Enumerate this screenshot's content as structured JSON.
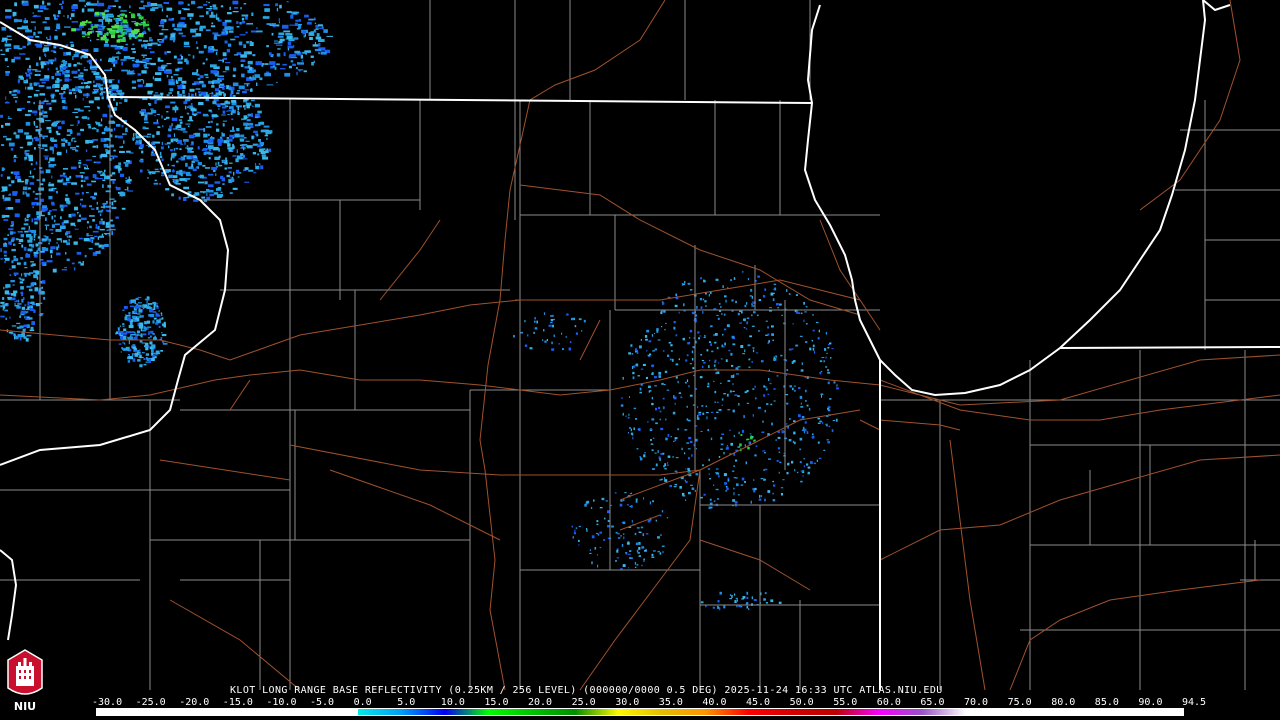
{
  "caption": "KLOT LONG RANGE BASE REFLECTIVITY (0.25KM / 256 LEVEL) (000000/0000 0.5 DEG) 2025-11-24 16:33 UTC  ATLAS.NIU.EDU",
  "logo": {
    "text": "NIU"
  },
  "scale": {
    "labels": [
      "-30.0",
      "-25.0",
      "-20.0",
      "-15.0",
      "-10.0",
      "-5.0",
      "0.0",
      "5.0",
      "10.0",
      "15.0",
      "20.0",
      "25.0",
      "30.0",
      "35.0",
      "40.0",
      "45.0",
      "50.0",
      "55.0",
      "60.0",
      "65.0",
      "70.0",
      "75.0",
      "80.0",
      "85.0",
      "90.0",
      "94.5"
    ],
    "colors": [
      "#ffffff",
      "#ffffff",
      "#ffffff",
      "#ffffff",
      "#ffffff",
      "#ffffff",
      "#04e9e7",
      "#019ff4",
      "#0300f4",
      "#02fd02",
      "#01c501",
      "#008e00",
      "#fdf802",
      "#e5bc00",
      "#fd9500",
      "#fd0000",
      "#d40000",
      "#bc0000",
      "#f800fd",
      "#9854c6",
      "#ffffff",
      "#ffffff",
      "#ffffff",
      "#ffffff",
      "#ffffff"
    ]
  },
  "colors": {
    "background": "#000000",
    "state_border": "#ffffff",
    "county_border": "#8c8c8c",
    "highway": "#a0522d",
    "echo_light": "#2aa7e0",
    "echo_mid": "#1a5ef0",
    "echo_green": "#29d13a"
  }
}
